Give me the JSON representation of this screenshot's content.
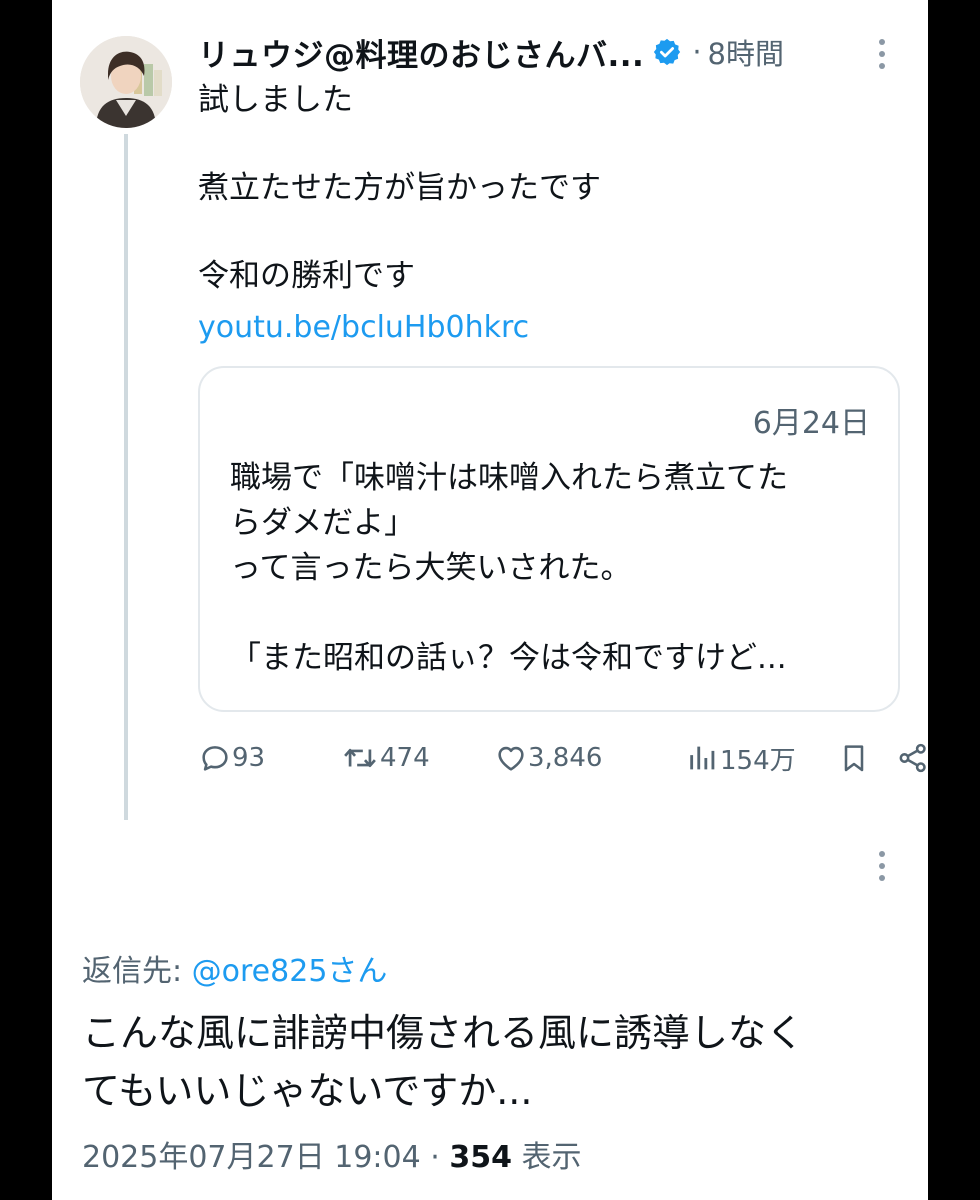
{
  "tweet": {
    "author_name": "リュウジ@料理のおじさんバ...",
    "separator": "·",
    "time_ago": "8時間",
    "body_lines": [
      "試しました",
      "",
      "煮立たせた方が旨かったです",
      "",
      "令和の勝利です"
    ],
    "link": "youtu.be/bcluHb0hkrc"
  },
  "quote": {
    "date": "6月24日",
    "lines": [
      "職場で「味噌汁は味噌入れたら煮立てた",
      "らダメだよ」",
      "って言ったら大笑いされた。",
      "",
      "「また昭和の話ぃ？今は令和ですけど..."
    ]
  },
  "actions": {
    "replies": "93",
    "retweets": "474",
    "likes": "3,846",
    "views": "154万"
  },
  "reply": {
    "reply_to_label": "返信先:",
    "reply_to_handle": "@ore825さん",
    "body_lines": [
      "こんな風に誹謗中傷される風に誘導しなく",
      "てもいいじゃないですか..."
    ],
    "datetime": "2025年07月27日 19:04",
    "separator": "·",
    "view_count": "354",
    "view_label": "表示"
  },
  "colors": {
    "accent": "#1d9bf0",
    "text": "#0f1419",
    "secondary": "#536471",
    "border": "#e3e8ec"
  },
  "icons": [
    "more-icon",
    "verified-badge-icon",
    "reply-icon",
    "retweet-icon",
    "like-icon",
    "views-icon",
    "bookmark-icon",
    "share-icon"
  ]
}
